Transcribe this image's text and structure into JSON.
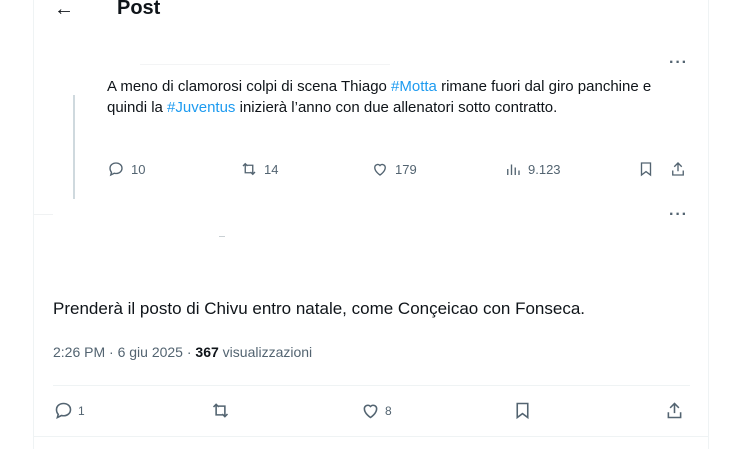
{
  "header": {
    "back_icon": "←",
    "title": "Post"
  },
  "parent_tweet": {
    "more_label": "···",
    "text_parts": [
      "A meno di clamorosi colpi di scena Thiago ",
      "#Motta",
      " rimane fuori dal giro panchine e quindi la ",
      "#Juventus",
      " inizierà l’anno con due allenatori sotto contratto."
    ],
    "replies": "10",
    "reposts": "14",
    "likes": "179",
    "views": "9.123"
  },
  "second_more_label": "···",
  "main_tweet": {
    "text": "Prenderà il posto di Chivu entro natale, come Conçeicao con Fonseca.",
    "time": "2:26 PM · 6 giu 2025 · ",
    "views_count": "367",
    "views_label": " visualizzazioni",
    "replies": "1",
    "reposts": "",
    "likes": "8"
  },
  "colors": {
    "link": "#1d9bf0",
    "muted": "#536471",
    "text": "#0f1419"
  }
}
